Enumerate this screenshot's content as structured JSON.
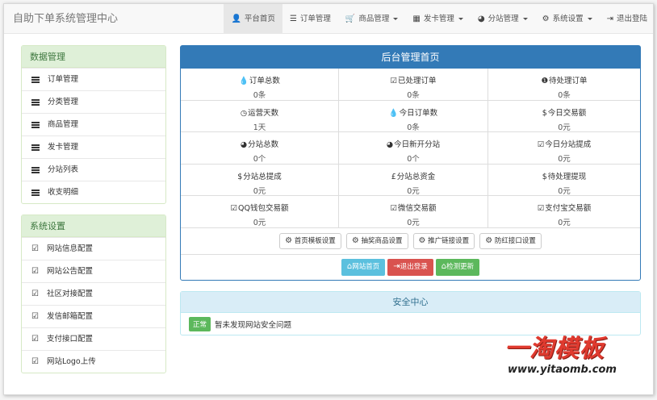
{
  "brand": "自助下单系统管理中心",
  "nav": [
    {
      "label": "平台首页",
      "icon": "user-icon",
      "active": true,
      "caret": false
    },
    {
      "label": "订单管理",
      "icon": "list-icon",
      "active": false,
      "caret": false
    },
    {
      "label": "商品管理",
      "icon": "cart-icon",
      "active": false,
      "caret": true
    },
    {
      "label": "发卡管理",
      "icon": "grid-icon",
      "active": false,
      "caret": true
    },
    {
      "label": "分站管理",
      "icon": "globe-icon",
      "active": false,
      "caret": true
    },
    {
      "label": "系统设置",
      "icon": "gear-icon",
      "active": false,
      "caret": true
    },
    {
      "label": "退出登陆",
      "icon": "logout-icon",
      "active": false,
      "caret": false
    }
  ],
  "sidebar": {
    "data_title": "数据管理",
    "data_items": [
      "订单管理",
      "分类管理",
      "商品管理",
      "发卡管理",
      "分站列表",
      "收支明细"
    ],
    "system_title": "系统设置",
    "system_items": [
      "网站信息配置",
      "网站公告配置",
      "社区对接配置",
      "发信邮箱配置",
      "支付接口配置",
      "网站Logo上传"
    ]
  },
  "main": {
    "title": "后台管理首页",
    "stats": [
      {
        "icon": "💧",
        "label": "订单总数",
        "value": "0条"
      },
      {
        "icon": "☑",
        "label": "已处理订单",
        "value": "0条"
      },
      {
        "icon": "❶",
        "label": "待处理订单",
        "value": "0条"
      },
      {
        "icon": "◷",
        "label": "运营天数",
        "value": "1天"
      },
      {
        "icon": "💧",
        "label": "今日订单数",
        "value": "0条"
      },
      {
        "icon": "$",
        "label": "今日交易额",
        "value": "0元"
      },
      {
        "icon": "◕",
        "label": "分站总数",
        "value": "0个"
      },
      {
        "icon": "◕",
        "label": "今日新开分站",
        "value": "0个"
      },
      {
        "icon": "☑",
        "label": "今日分站提成",
        "value": "0元"
      },
      {
        "icon": "$",
        "label": "分站总提成",
        "value": "0元"
      },
      {
        "icon": "£",
        "label": "分站总资金",
        "value": "0元"
      },
      {
        "icon": "$",
        "label": "待处理提现",
        "value": "0元"
      },
      {
        "icon": "☑",
        "label": "QQ钱包交易额",
        "value": "0元"
      },
      {
        "icon": "☑",
        "label": "微信交易额",
        "value": "0元"
      },
      {
        "icon": "☑",
        "label": "支付宝交易额",
        "value": "0元"
      }
    ],
    "settings_buttons": [
      "首页模板设置",
      "抽奖商品设置",
      "推广链接设置",
      "防红接口设置"
    ],
    "action_buttons": {
      "home": "网站首页",
      "logout": "退出登录",
      "update": "检测更新"
    }
  },
  "security": {
    "title": "安全中心",
    "badge": "正常",
    "message": "暂未发现网站安全问题"
  },
  "watermark": {
    "logo": "一淘模板",
    "url": "www.yitaomb.com"
  }
}
